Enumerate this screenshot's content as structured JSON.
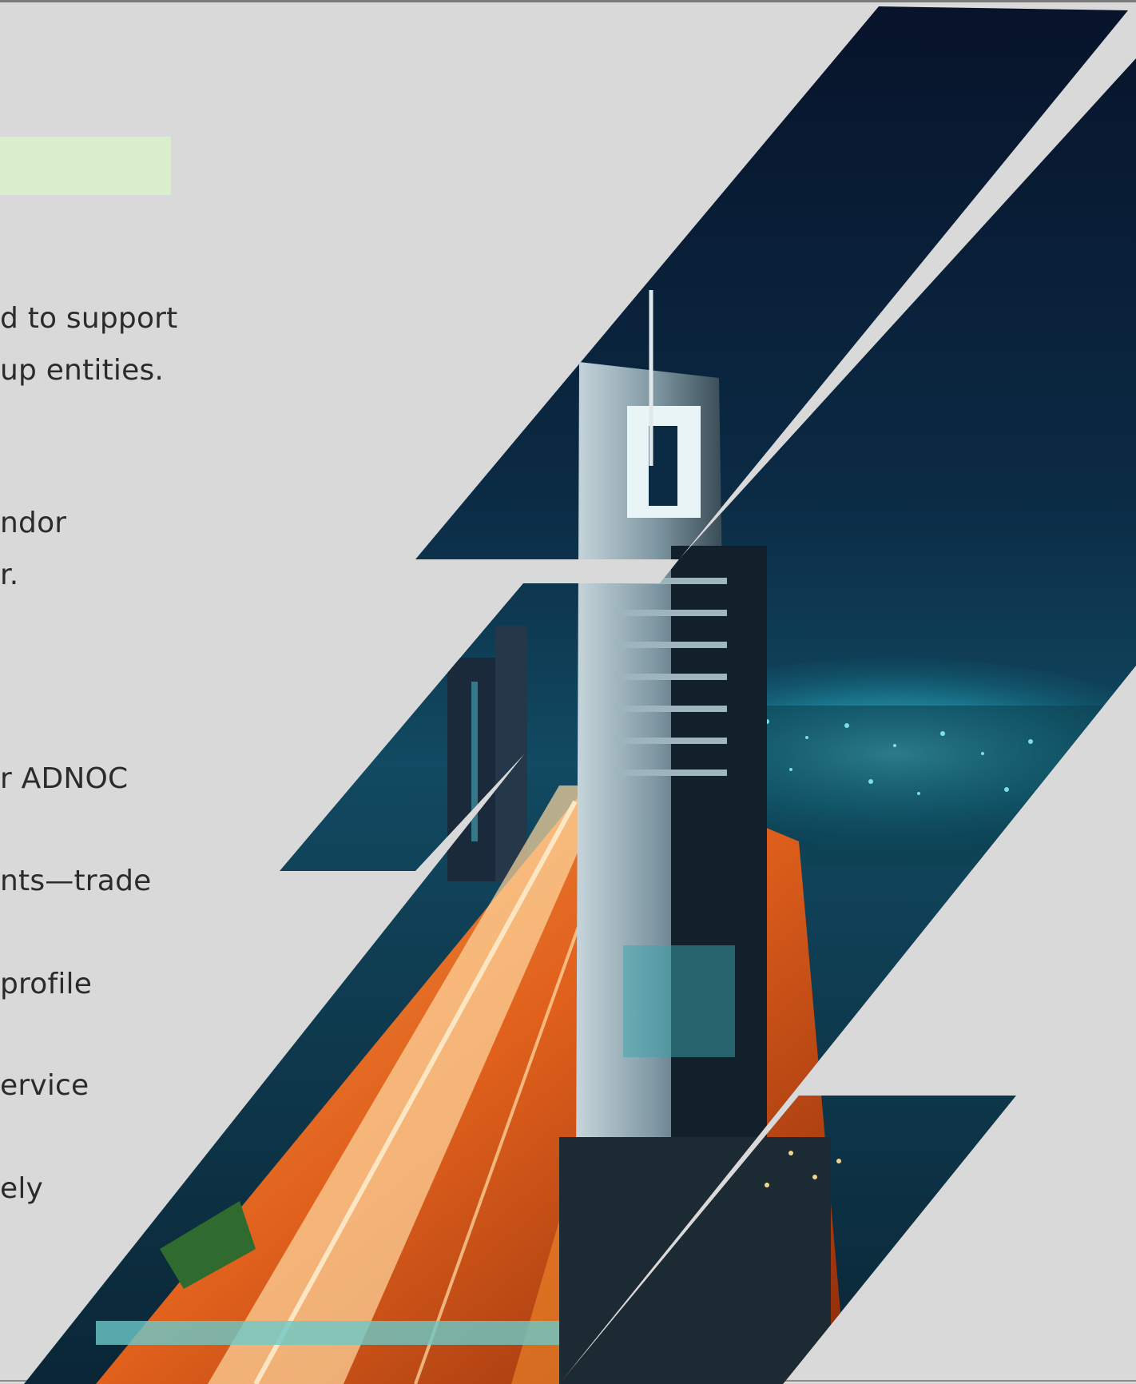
{
  "text_fragments": [
    "d to support",
    "up entities.",
    "ndor",
    "r.",
    "r ADNOC",
    "nts—trade",
    "profile",
    "ervice",
    "ely"
  ],
  "colors": {
    "background": "#d9d9d9",
    "highlight_bar": "#d9efcb",
    "text": "#2b2b2b"
  }
}
